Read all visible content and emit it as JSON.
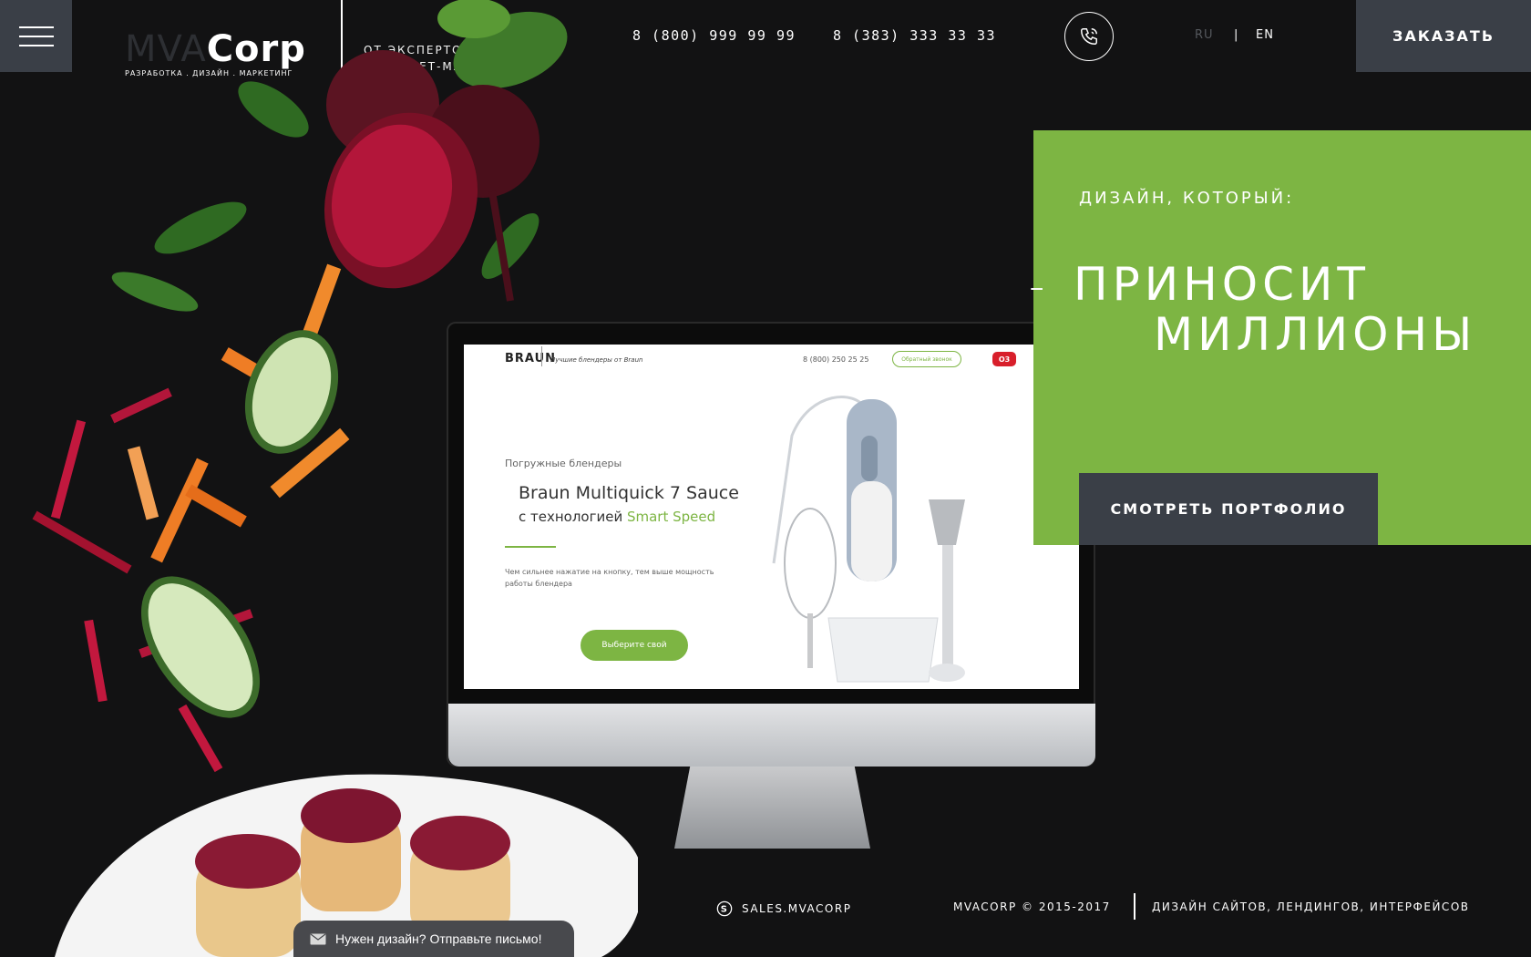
{
  "header": {
    "logo_main": "MVA",
    "logo_accent": "Corp",
    "logo_sub": "РАЗРАБОТКА . ДИЗАЙН . МАРКЕТИНГ",
    "tagline_line1": "ОТ ЭКСПЕРТОВ",
    "tagline_line2": "ИНТЕРНЕТ-МАРКЕТИНГА",
    "phone_1": "8 (800) 999 99 99",
    "phone_2": "8 (383) 333 33 33",
    "lang_ru": "RU",
    "lang_separator": "|",
    "lang_en": "EN",
    "order_label": "ЗАКАЗАТЬ"
  },
  "hero": {
    "eyebrow": "ДИЗАЙН, КОТОРЫЙ:",
    "dash": "-",
    "line1": "ПРИНОСИТ",
    "line2": "МИЛЛИОНЫ",
    "portfolio_label": "СМОТРЕТЬ ПОРТФОЛИО",
    "accent_color": "#7db543"
  },
  "mockup": {
    "brand": "BRAUN",
    "tagline": "Лучшие блендеры от Braun",
    "phone": "8 (800) 250 25 25",
    "callback_label": "Обратный звонок",
    "badge": "О3",
    "category": "Погружные блендеры",
    "title": "Braun Multiquick 7 Sauce",
    "subtitle_prefix": "с технологией ",
    "subtitle_accent": "Smart Speed",
    "description": "Чем сильнее нажатие на кнопку, тем выше мощность работы блендера",
    "cta_label": "Выберите свой"
  },
  "footer": {
    "skype": "SALES.MVACORP",
    "copyright": "MVACORP © 2015-2017",
    "tagline": "ДИЗАЙН САЙТОВ, ЛЕНДИНГОВ, ИНТЕРФЕЙСОВ",
    "mail_label": "Нужен дизайн? Отправьте письмо!"
  },
  "icons": [
    "menu-icon",
    "phone-icon",
    "skype-icon",
    "mail-icon"
  ]
}
